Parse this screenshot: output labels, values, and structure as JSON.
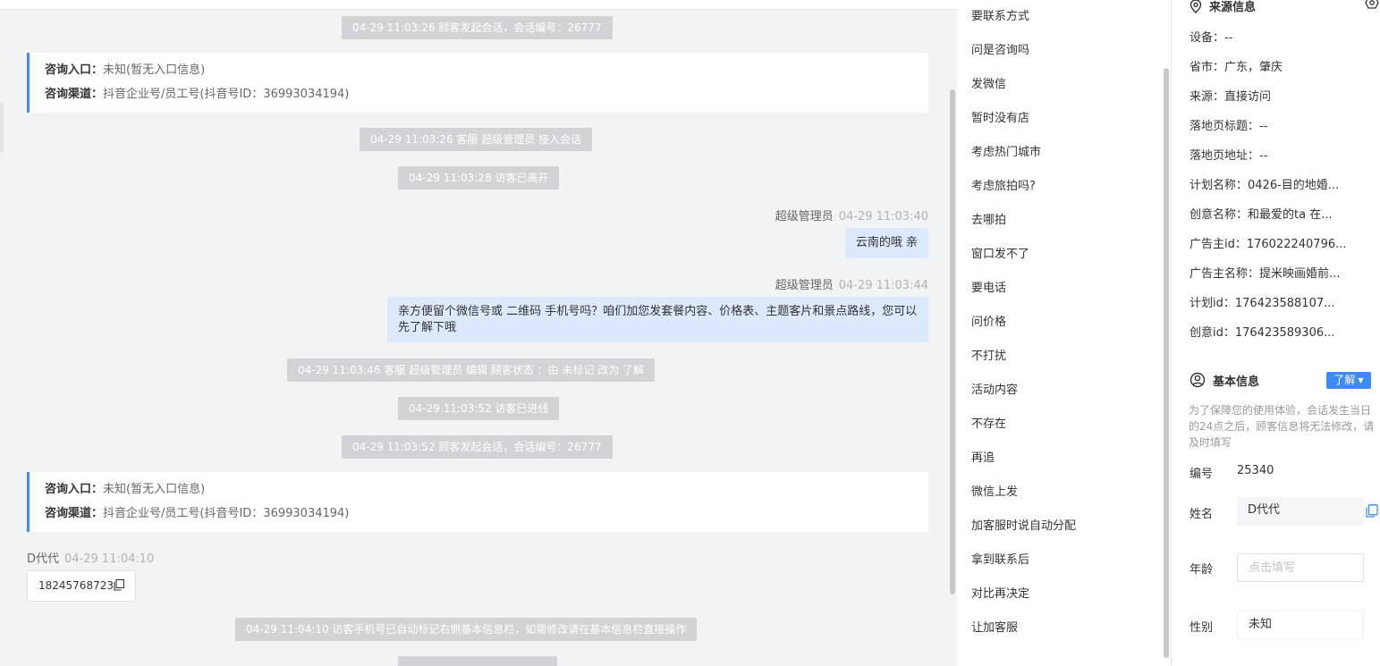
{
  "chat": {
    "sys1": "04-29 11:03:26 顾客发起会话，会话编号：26777",
    "card1": {
      "entry_label": "咨询入口：",
      "entry_value": "未知(暂无入口信息)",
      "channel_label": "咨询渠道：",
      "channel_value": "抖音企业号/员工号(抖音号ID：36993034194)"
    },
    "sys2": "04-29 11:03:26 客服 超级管理员 接入会话",
    "sys3": "04-29 11:03:28 访客已离开",
    "msg1": {
      "sender": "超级管理员",
      "time": "04-29 11:03:40",
      "text": "云南的哦 亲"
    },
    "msg2": {
      "sender": "超级管理员",
      "time": "04-29 11:03:44",
      "text": "亲方便留个微信号或 二维码 手机号吗？咱们加您发套餐内容、价格表、主题客片和景点路线，您可以先了解下哦"
    },
    "sys4": "04-29 11:03:46 客服 超级管理员 编辑 顾客状态 ：由 未标记 改为 了解",
    "sys5": "04-29 11:03:52 访客已进线",
    "sys6": "04-29 11:03:52 顾客发起会话，会话编号：26777",
    "card2": {
      "entry_label": "咨询入口：",
      "entry_value": "未知(暂无入口信息)",
      "channel_label": "咨询渠道：",
      "channel_value": "抖音企业号/员工号(抖音号ID：36993034194)"
    },
    "msg3": {
      "sender": "D代代",
      "time": "04-29 11:04:10",
      "text": "18245768723"
    },
    "sys7": "04-29 11:04:10 访客手机号已自动标记右侧基本信息栏，如需修改请在基本信息栏直接操作"
  },
  "quick_replies": [
    "要联系方式",
    "问是咨询吗",
    "发微信",
    "暂时没有店",
    "考虑热门城市",
    "考虑旅拍吗?",
    "去哪拍",
    "窗口发不了",
    "要电话",
    "问价格",
    "不打扰",
    "活动内容",
    "不存在",
    "再追",
    "微信上发",
    "加客服时说自动分配",
    "拿到联系后",
    "对比再决定",
    "让加客服"
  ],
  "source": {
    "title": "来源信息",
    "rows": [
      "设备：--",
      "省市：广东，肇庆",
      "来源：直接访问",
      "落地页标题：--",
      "落地页地址：--",
      "计划名称：0426-目的地婚...",
      "创意名称：和最爱的ta 在...",
      "广告主id：176022240796...",
      "广告主名称：提米映画婚前...",
      "计划id：176423588107...",
      "创意id：176423589306..."
    ]
  },
  "basic": {
    "title": "基本信息",
    "learn_label": "了解",
    "hint": "为了保障您的使用体验，会话发生当日的24点之后，顾客信息将无法修改，请及时填写",
    "id_label": "编号",
    "id_value": "25340",
    "name_label": "姓名",
    "name_value": "D代代",
    "age_label": "年龄",
    "age_placeholder": "点击填写",
    "gender_label": "性别",
    "gender_value": "未知"
  }
}
